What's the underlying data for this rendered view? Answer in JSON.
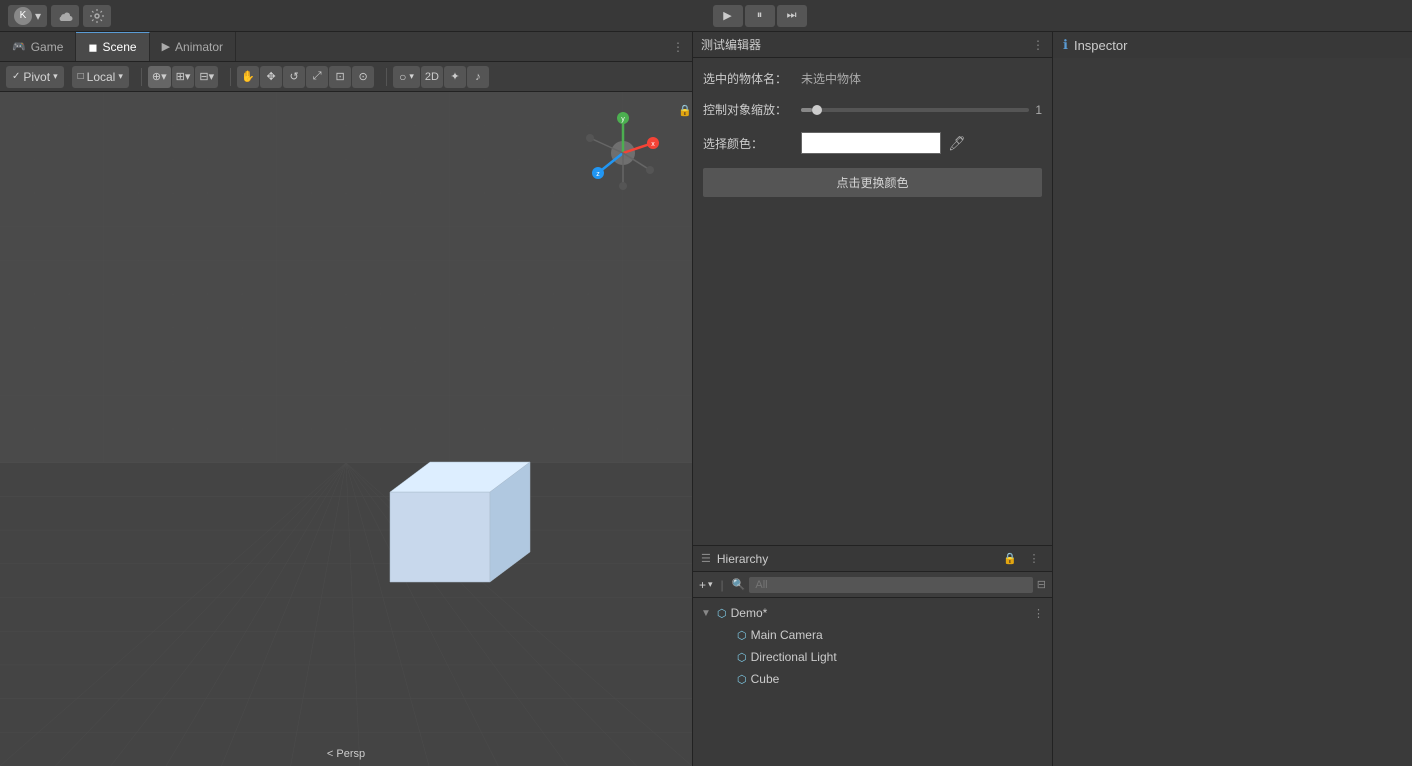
{
  "topbar": {
    "account_label": "K",
    "account_dropdown_arrow": "▾",
    "play_btn": "▶",
    "pause_btn": "⏸",
    "step_btn": "⏭"
  },
  "tabs": {
    "items": [
      {
        "id": "game",
        "label": "Game",
        "icon": "🎮",
        "active": false
      },
      {
        "id": "scene",
        "label": "Scene",
        "icon": "◼",
        "active": true
      },
      {
        "id": "animator",
        "label": "Animator",
        "icon": "▶",
        "active": false
      }
    ]
  },
  "toolbar": {
    "pivot_label": "Pivot",
    "local_label": "Local",
    "tools": [
      "⊕",
      "✥",
      "↺",
      "⤢",
      "⊡",
      "⊙"
    ],
    "view_2d": "2D"
  },
  "editor_panel": {
    "title": "测试编辑器",
    "selected_label": "选中的物体名：",
    "selected_value": "未选中物体",
    "scale_label": "控制对象缩放：",
    "scale_value": "1",
    "color_label": "选择颜色：",
    "change_btn": "点击更换颜色",
    "more_icon": "⋮"
  },
  "hierarchy": {
    "title": "Hierarchy",
    "title_icon": "☰",
    "search_placeholder": "All",
    "scene_name": "Demo*",
    "items": [
      {
        "id": "main-camera",
        "label": "Main Camera",
        "indent": true
      },
      {
        "id": "directional-light",
        "label": "Directional Light",
        "indent": true
      },
      {
        "id": "cube",
        "label": "Cube",
        "indent": true
      }
    ]
  },
  "inspector": {
    "title": "Inspector",
    "icon": "ℹ"
  },
  "scene": {
    "perspective_label": "< Persp",
    "gizmo_axes": {
      "y_label": "y",
      "x_label": "x",
      "z_label": "z"
    }
  }
}
